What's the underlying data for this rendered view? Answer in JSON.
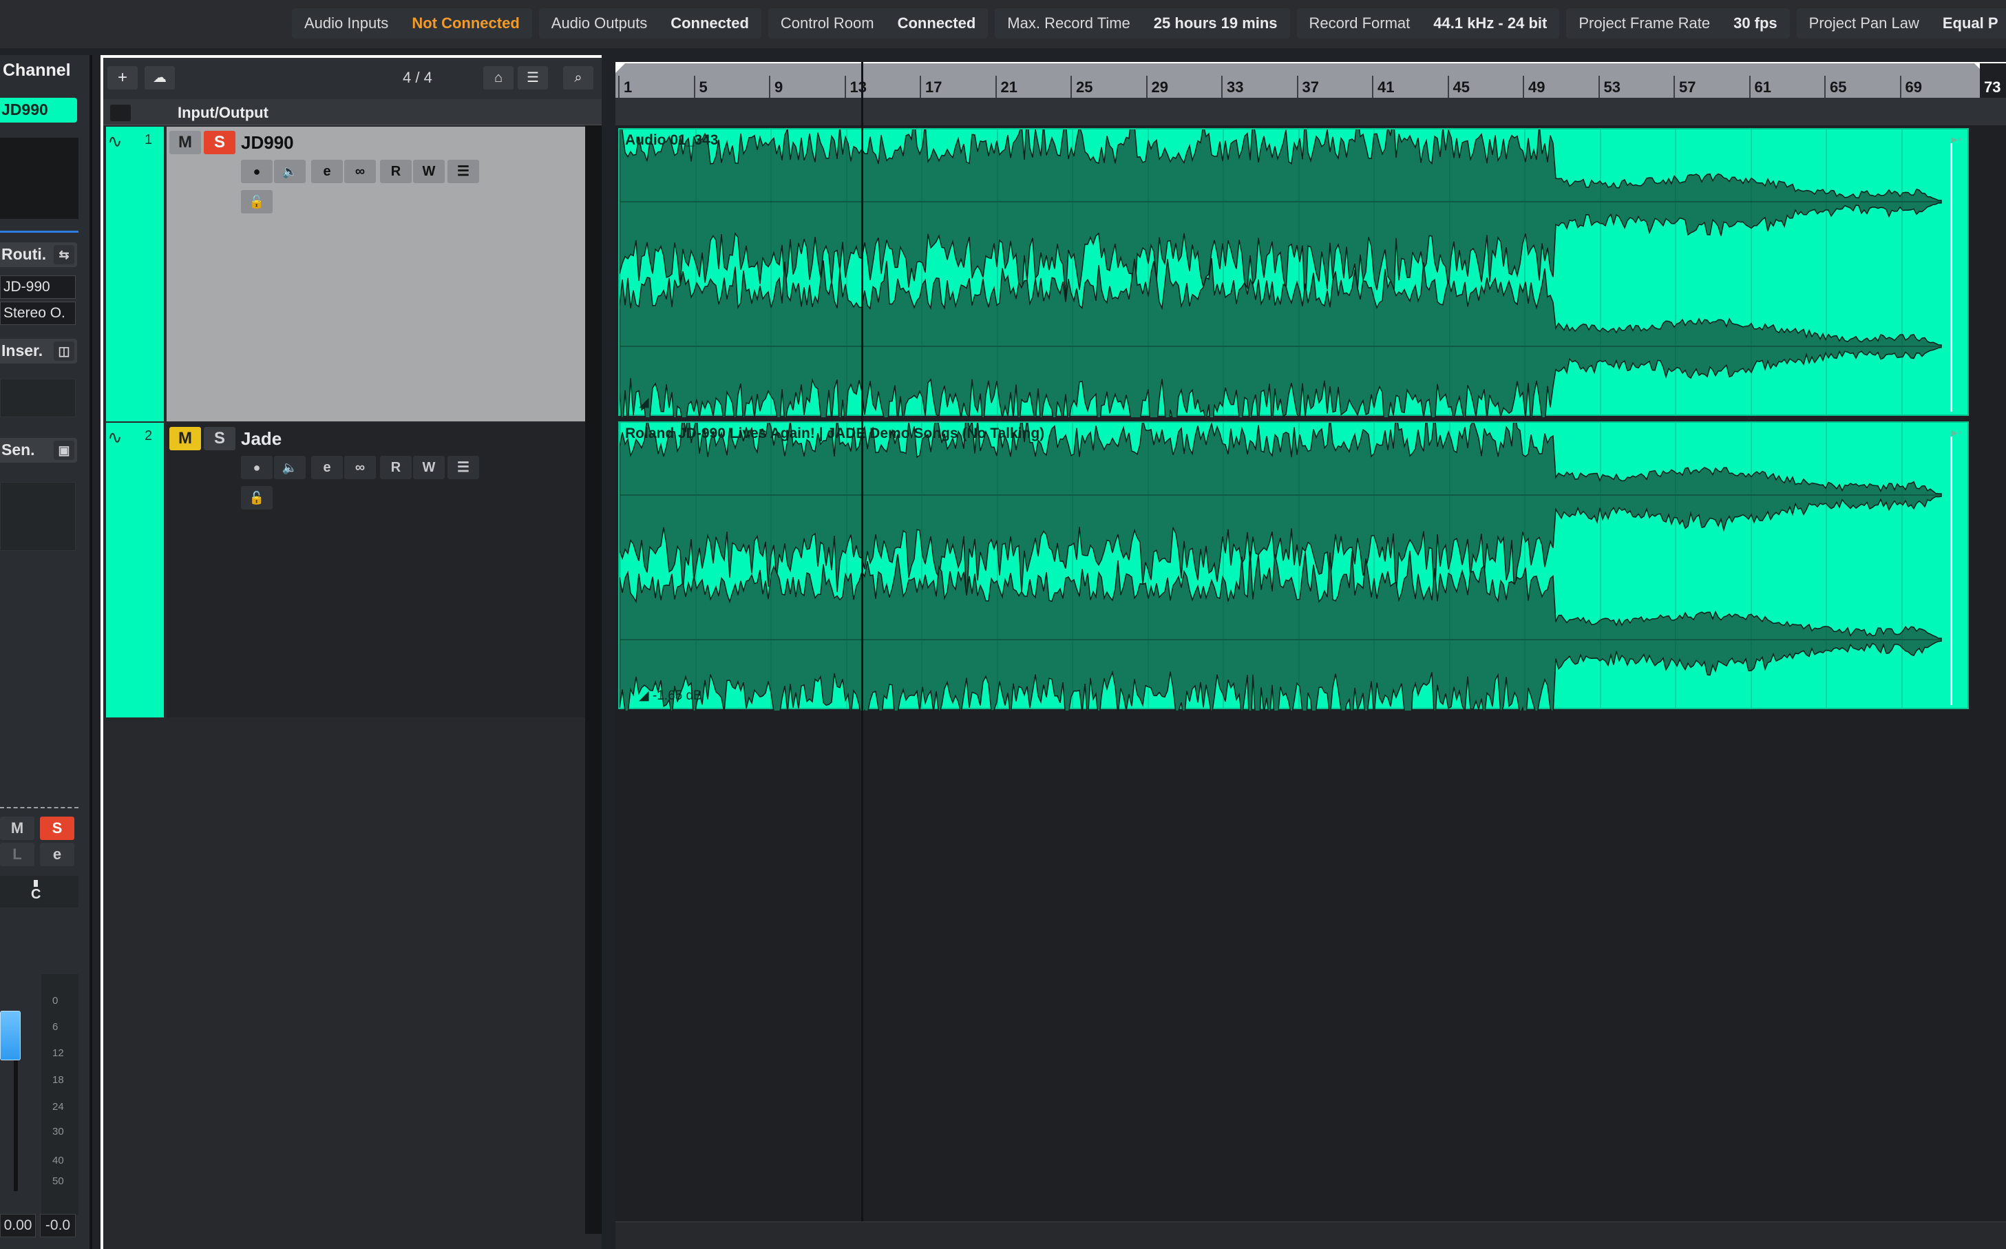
{
  "status_bar": [
    {
      "label": "Audio Inputs",
      "value": "Not Connected",
      "warn": true
    },
    {
      "label": "Audio Outputs",
      "value": "Connected"
    },
    {
      "label": "Control Room",
      "value": "Connected"
    },
    {
      "label": "Max. Record Time",
      "value": "25 hours 19 mins"
    },
    {
      "label": "Record Format",
      "value": "44.1 kHz - 24 bit"
    },
    {
      "label": "Project Frame Rate",
      "value": "30 fps"
    },
    {
      "label": "Project Pan Law",
      "value": "Equal P"
    }
  ],
  "inspector": {
    "title": "Channel",
    "channel_name": "JD990",
    "routing_label": "Routi.",
    "routing_input": "JD-990",
    "routing_output": "Stereo O.",
    "inserts_label": "Inser.",
    "sends_label": "Sen.",
    "mute": "M",
    "solo": "S",
    "listen": "L",
    "edit": "e",
    "pan": "C",
    "scale": [
      "0",
      "6",
      "12",
      "18",
      "24",
      "30",
      "40",
      "50"
    ],
    "volume_value": "0.00",
    "pan_value": "-0.0",
    "read": "R",
    "write": "W"
  },
  "track_list": {
    "counter": "4 / 4",
    "folder_label": "Input/Output",
    "tracks": [
      {
        "number": "1",
        "name": "JD990",
        "mute": "M",
        "solo": "S",
        "read": "R",
        "write": "W",
        "edit": "e"
      },
      {
        "number": "2",
        "name": "Jade",
        "mute": "M",
        "solo": "S",
        "read": "R",
        "write": "W",
        "edit": "e"
      }
    ]
  },
  "ruler": {
    "bars": [
      "1",
      "5",
      "9",
      "13",
      "17",
      "21",
      "25",
      "29",
      "33",
      "37",
      "41",
      "45",
      "49",
      "53",
      "57",
      "61",
      "65",
      "69"
    ],
    "end_bar": "73"
  },
  "events": [
    {
      "name": "Audio 01_343",
      "volume": ""
    },
    {
      "name": "Roland JD-990 Lives Again! | JADE Demo Songs (No Talking)",
      "volume": "-1.65 dB"
    }
  ],
  "colors": {
    "track_color": "#00f9b9",
    "solo_active": "#e5442c",
    "mute_active": "#e9c31c",
    "status_warn": "#f19b2b"
  }
}
